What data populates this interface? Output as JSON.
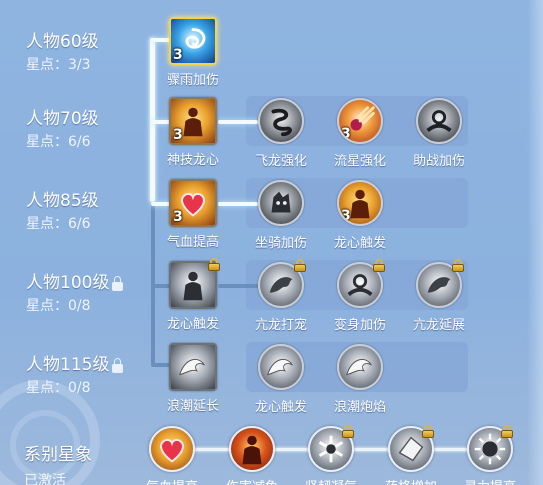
{
  "tiers": [
    {
      "title": "人物60级",
      "stars": "星点：3/3",
      "locked": false
    },
    {
      "title": "人物70级",
      "stars": "星点：6/6",
      "locked": false
    },
    {
      "title": "人物85级",
      "stars": "星点：6/6",
      "locked": false
    },
    {
      "title": "人物100级",
      "stars": "星点：0/8",
      "locked": true
    },
    {
      "title": "人物115级",
      "stars": "星点：0/8",
      "locked": true
    }
  ],
  "nodes": {
    "t60_main": {
      "label": "骤雨加伤",
      "level": "3",
      "icon": "vortex-icon",
      "color": "#3aa5e8"
    },
    "t70_main": {
      "label": "神技龙心",
      "level": "3",
      "icon": "flame-figure-icon",
      "color": "#e9a12e"
    },
    "t70_1": {
      "label": "飞龙强化",
      "level": "",
      "icon": "coiled-dragon-icon"
    },
    "t70_2": {
      "label": "流星强化",
      "level": "3",
      "icon": "meteor-icon"
    },
    "t70_3": {
      "label": "助战加伤",
      "level": "",
      "icon": "hands-orb-icon"
    },
    "t85_main": {
      "label": "气血提高",
      "level": "3",
      "icon": "heart-icon",
      "color": "#e9a12e"
    },
    "t85_1": {
      "label": "坐骑加伤",
      "level": "",
      "icon": "beast-head-icon"
    },
    "t85_2": {
      "label": "龙心触发",
      "level": "3",
      "icon": "flame-figure-icon"
    },
    "t100_main": {
      "label": "龙心触发",
      "level": "",
      "icon": "figure-silhouette-icon"
    },
    "t100_1": {
      "label": "亢龙打宠",
      "level": "",
      "icon": "dragon-head-icon"
    },
    "t100_2": {
      "label": "变身加伤",
      "level": "",
      "icon": "hands-orb-icon"
    },
    "t100_3": {
      "label": "亢龙延展",
      "level": "",
      "icon": "dragon-head-icon"
    },
    "t115_main": {
      "label": "浪潮延长",
      "level": "",
      "icon": "wave-icon"
    },
    "t115_1": {
      "label": "龙心触发",
      "level": "",
      "icon": "wave-icon"
    },
    "t115_2": {
      "label": "浪潮炮焰",
      "level": "",
      "icon": "wave-icon"
    }
  },
  "system": {
    "title": "系别星象",
    "status": "已激活",
    "nodes": [
      {
        "label": "气血提高",
        "icon": "heart-icon",
        "locked": false
      },
      {
        "label": "伤害减免",
        "icon": "flame-figure-icon",
        "locked": false
      },
      {
        "label": "坚韧凝气",
        "icon": "frost-orb-icon",
        "locked": true
      },
      {
        "label": "药格增加",
        "icon": "crystal-icon",
        "locked": true
      },
      {
        "label": "灵力提高",
        "icon": "burst-orb-icon",
        "locked": true
      }
    ]
  },
  "colors": {
    "background": "#8fb4e0",
    "panel": "#82a5d7",
    "connector": "#6a8fbd",
    "lit_connector": "#f4fbff"
  }
}
